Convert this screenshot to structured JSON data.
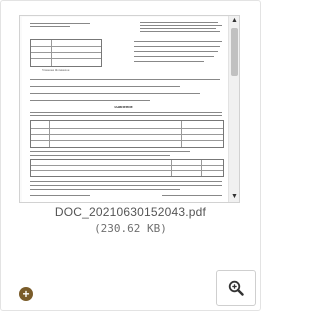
{
  "file": {
    "name": "DOC_20210630152043.pdf",
    "size": "(230.62 KB)"
  },
  "document": {
    "heading": "ЗАЯВЛЕНИЕ",
    "applicant": "Усманова Фотимахон"
  },
  "icons": {
    "add": "plus-circle-icon",
    "zoom": "zoom-in-icon",
    "scroll_up": "scroll-up-arrow-icon",
    "scroll_down": "scroll-down-arrow-icon"
  },
  "colors": {
    "add_button": "#7a5c2a",
    "border": "#cfcfcf",
    "text_muted": "#555555"
  }
}
